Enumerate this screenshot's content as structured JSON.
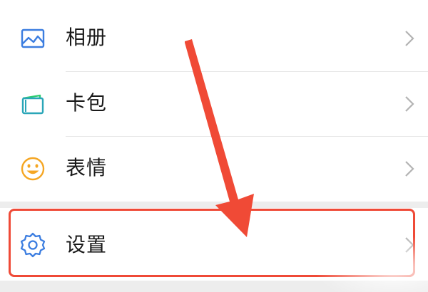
{
  "menu": {
    "items": [
      {
        "label": "相册",
        "icon": "photo-album-icon",
        "accent": "#3b7de0"
      },
      {
        "label": "卡包",
        "icon": "card-wallet-icon",
        "accent": "#2aa6b8"
      },
      {
        "label": "表情",
        "icon": "smiley-icon",
        "accent": "#f5a623"
      }
    ],
    "settings": {
      "label": "设置",
      "icon": "gear-icon",
      "accent": "#3b7de0"
    }
  },
  "annotation": {
    "highlight_color": "#ef4a37",
    "arrow_color": "#f04a36"
  }
}
